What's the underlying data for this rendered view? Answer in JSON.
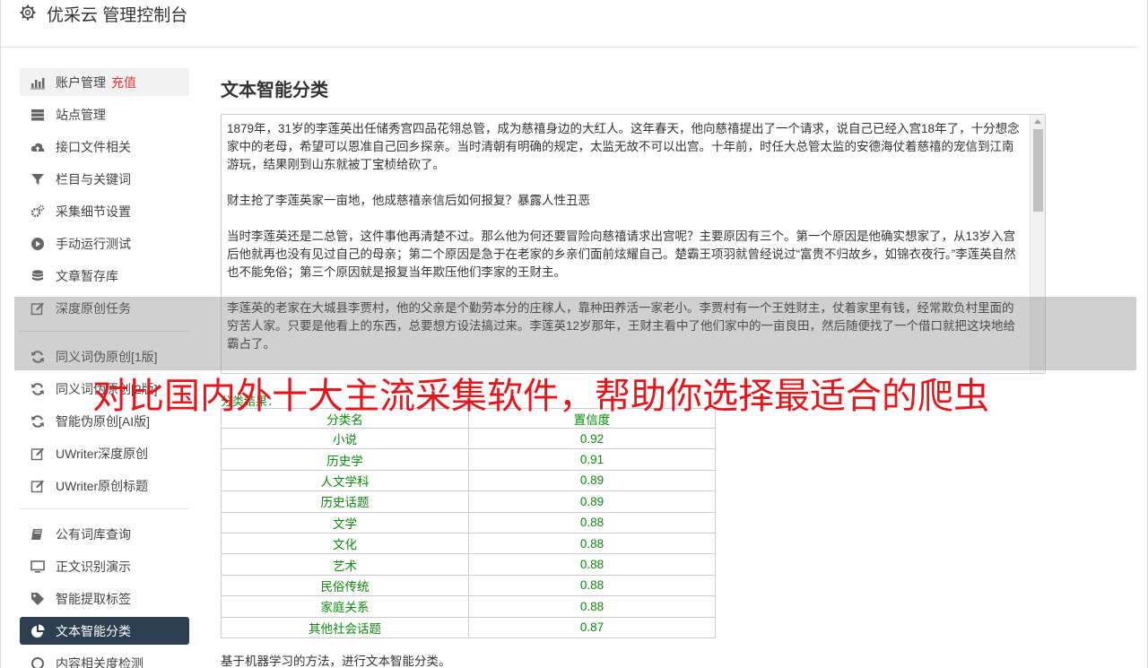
{
  "app": {
    "title": "优采云 管理控制台"
  },
  "sidebar": {
    "groups": [
      [
        {
          "label": "账户管理",
          "extra": "充值",
          "icon": "bar-chart-icon"
        },
        {
          "label": "站点管理",
          "icon": "server-icon"
        },
        {
          "label": "接口文件相关",
          "icon": "cloud-upload-icon"
        },
        {
          "label": "栏目与关键词",
          "icon": "filter-icon"
        },
        {
          "label": "采集细节设置",
          "icon": "gears-icon"
        },
        {
          "label": "手动运行测试",
          "icon": "play-circle-icon"
        },
        {
          "label": "文章暂存库",
          "icon": "database-icon"
        },
        {
          "label": "深度原创任务",
          "icon": "edit-icon"
        }
      ],
      [
        {
          "label": "同义词伪原创[1版]",
          "icon": "refresh-icon"
        },
        {
          "label": "同义词伪原创[2版]",
          "icon": "refresh-icon"
        },
        {
          "label": "智能伪原创[AI版]",
          "icon": "refresh-icon"
        },
        {
          "label": "UWriter深度原创",
          "icon": "edit-icon"
        },
        {
          "label": "UWriter原创标题",
          "icon": "edit-icon"
        }
      ],
      [
        {
          "label": "公有词库查询",
          "icon": "book-icon"
        },
        {
          "label": "正文识别演示",
          "icon": "monitor-icon"
        },
        {
          "label": "智能提取标签",
          "icon": "tag-icon"
        },
        {
          "label": "文本智能分类",
          "icon": "pie-chart-icon",
          "active": true
        },
        {
          "label": "内容相关度检测",
          "icon": "link-icon"
        }
      ]
    ]
  },
  "main": {
    "title": "文本智能分类",
    "article_paragraphs": [
      "1879年，31岁的李莲英出任储秀宫四品花翎总管，成为慈禧身边的大红人。这年春天，他向慈禧提出了一个请求，说自己已经入宫18年了，十分想念家中的老母，希望可以恩准自己回乡探亲。当时清朝有明确的规定，太监无故不可以出宫。十年前，时任大总管太监的安德海仗着慈禧的宠信到江南游玩，结果刚到山东就被丁宝桢给砍了。",
      "财主抢了李莲英家一亩地，他成慈禧亲信后如何报复？暴露人性丑恶",
      "当时李莲英还是二总管，这件事他再清楚不过。那么他为何还要冒险向慈禧请求出宫呢？主要原因有三个。第一个原因是他确实想家了，从13岁入宫后他就再也没有见过自己的母亲；第二个原因是急于在老家的乡亲们面前炫耀自己。楚霸王项羽就曾经说过“富贵不归故乡，如锦衣夜行。”李莲英自然也不能免俗；第三个原因就是报复当年欺压他们李家的王财主。",
      "李莲英的老家在大城县李贾村，他的父亲是个勤劳本分的庄稼人，靠种田养活一家老小。李贾村有一个王姓财主，仗着家里有钱，经常欺负村里面的穷苦人家。只要是他看上的东西，总要想方设法搞过来。李莲英12岁那年，王财主看中了他们家中的一亩良田，然后随便找了一个借口就把这块地给霸占了。",
      "财主抢了李莲英家一亩地，他成慈禧亲信后如何报复？暴露人性丑恶"
    ],
    "result_label": "分类结果：",
    "table": {
      "headers": [
        "分类名",
        "置信度"
      ],
      "rows": [
        [
          "小说",
          "0.92"
        ],
        [
          "历史学",
          "0.91"
        ],
        [
          "人文学科",
          "0.89"
        ],
        [
          "历史话题",
          "0.89"
        ],
        [
          "文学",
          "0.88"
        ],
        [
          "文化",
          "0.88"
        ],
        [
          "艺术",
          "0.88"
        ],
        [
          "民俗传统",
          "0.88"
        ],
        [
          "家庭关系",
          "0.88"
        ],
        [
          "其他社会话题",
          "0.87"
        ]
      ]
    },
    "footnote": "基于机器学习的方法，进行文本智能分类。"
  },
  "overlay": {
    "headline": "对比国内外十大主流采集软件，帮助你选择最适合的爬虫"
  },
  "colors": {
    "active_bg": "#2d3e50",
    "charge": "#e33333",
    "result_green": "#0a8a0a",
    "headline_red": "#e8161a"
  }
}
